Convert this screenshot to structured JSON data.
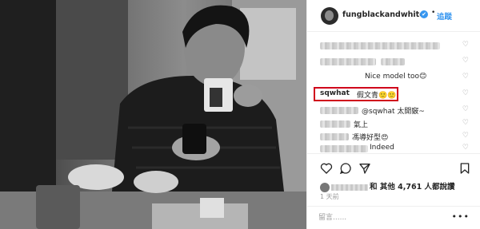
{
  "post": {
    "username": "fungblackandwhite",
    "verified_mark": "✔",
    "separator": "•",
    "follow_label": "追蹤"
  },
  "comments": [
    {
      "id": "c1",
      "text": "",
      "blurred": true
    },
    {
      "id": "c2",
      "text": "",
      "blurred": true
    },
    {
      "id": "c3",
      "text": "Nice model too😊",
      "blurred_prefix": false
    },
    {
      "id": "c4",
      "user": "sqwhat",
      "text": "假文青🙂🙂"
    },
    {
      "id": "c5",
      "text": "@sqwhat 太開竅~"
    },
    {
      "id": "c6",
      "text": "氣上"
    },
    {
      "id": "c7",
      "text": "馮導好型😍"
    },
    {
      "id": "c8",
      "text": "Indeed"
    }
  ],
  "likes": {
    "prefix": "和",
    "text": "其他 4,761 人都說讚"
  },
  "time_ago": "1 天前",
  "add_comment_placeholder": "留言......",
  "more_label": "•••",
  "icons": {
    "heart": "heart-icon",
    "comment": "comment-icon",
    "share": "share-icon",
    "bookmark": "bookmark-icon"
  },
  "colors": {
    "follow_blue": "#3897f0",
    "highlight_red": "#d0021b",
    "verified_blue": "#3897f0"
  }
}
